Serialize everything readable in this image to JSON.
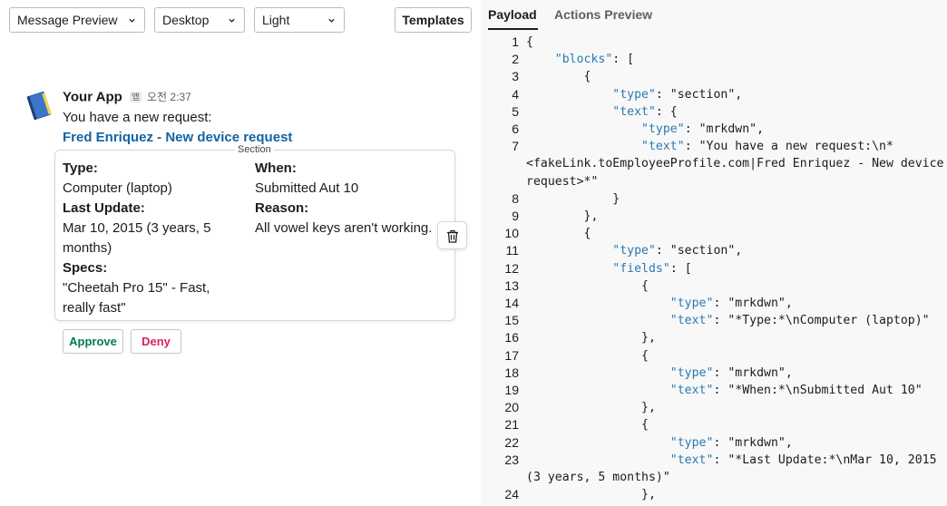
{
  "toolbar": {
    "view_select": "Message Preview",
    "device_select": "Desktop",
    "theme_select": "Light",
    "templates_label": "Templates"
  },
  "message": {
    "app_name": "Your App",
    "app_badge": "앱",
    "time": "오전 2:37",
    "text": "You have a new request:",
    "link_text": "Fred Enriquez - New device request"
  },
  "section": {
    "label": "Section",
    "fields": {
      "type_label": "Type:",
      "type_value": "Computer (laptop)",
      "when_label": "When:",
      "when_value": "Submitted Aut 10",
      "update_label": "Last Update:",
      "update_value": "Mar 10, 2015 (3 years, 5 months)",
      "reason_label": "Reason:",
      "reason_value": "All vowel keys aren't working.",
      "specs_label": "Specs:",
      "specs_value": "\"Cheetah Pro 15\" - Fast, really fast\""
    }
  },
  "actions": {
    "approve_label": "Approve",
    "deny_label": "Deny"
  },
  "tabs": {
    "payload": "Payload",
    "actions_preview": "Actions Preview"
  },
  "code_lines": [
    {
      "n": "1",
      "indent": "",
      "key": "",
      "rest": "{"
    },
    {
      "n": "2",
      "indent": "    ",
      "key": "\"blocks\"",
      "rest": ": ["
    },
    {
      "n": "3",
      "indent": "        ",
      "key": "",
      "rest": "{"
    },
    {
      "n": "4",
      "indent": "            ",
      "key": "\"type\"",
      "rest": ": \"section\","
    },
    {
      "n": "5",
      "indent": "            ",
      "key": "\"text\"",
      "rest": ": {"
    },
    {
      "n": "6",
      "indent": "                ",
      "key": "\"type\"",
      "rest": ": \"mrkdwn\","
    },
    {
      "n": "7",
      "indent": "                ",
      "key": "\"text\"",
      "rest": ": \"You have a new request:\\n*<fakeLink.toEmployeeProfile.com|Fred Enriquez - New device request>*\""
    },
    {
      "n": "8",
      "indent": "            ",
      "key": "",
      "rest": "}"
    },
    {
      "n": "9",
      "indent": "        ",
      "key": "",
      "rest": "},"
    },
    {
      "n": "10",
      "indent": "        ",
      "key": "",
      "rest": "{"
    },
    {
      "n": "11",
      "indent": "            ",
      "key": "\"type\"",
      "rest": ": \"section\","
    },
    {
      "n": "12",
      "indent": "            ",
      "key": "\"fields\"",
      "rest": ": ["
    },
    {
      "n": "13",
      "indent": "                ",
      "key": "",
      "rest": "{"
    },
    {
      "n": "14",
      "indent": "                    ",
      "key": "\"type\"",
      "rest": ": \"mrkdwn\","
    },
    {
      "n": "15",
      "indent": "                    ",
      "key": "\"text\"",
      "rest": ": \"*Type:*\\nComputer (laptop)\""
    },
    {
      "n": "16",
      "indent": "                ",
      "key": "",
      "rest": "},"
    },
    {
      "n": "17",
      "indent": "                ",
      "key": "",
      "rest": "{"
    },
    {
      "n": "18",
      "indent": "                    ",
      "key": "\"type\"",
      "rest": ": \"mrkdwn\","
    },
    {
      "n": "19",
      "indent": "                    ",
      "key": "\"text\"",
      "rest": ": \"*When:*\\nSubmitted Aut 10\""
    },
    {
      "n": "20",
      "indent": "                ",
      "key": "",
      "rest": "},"
    },
    {
      "n": "21",
      "indent": "                ",
      "key": "",
      "rest": "{"
    },
    {
      "n": "22",
      "indent": "                    ",
      "key": "\"type\"",
      "rest": ": \"mrkdwn\","
    },
    {
      "n": "23",
      "indent": "                    ",
      "key": "\"text\"",
      "rest": ": \"*Last Update:*\\nMar 10, 2015 (3 years, 5 months)\""
    },
    {
      "n": "24",
      "indent": "                ",
      "key": "",
      "rest": "},"
    }
  ],
  "colors": {
    "link": "#1264a3",
    "approve": "#007a5a",
    "deny": "#e01e5a",
    "json_key": "#2a7ab0"
  }
}
